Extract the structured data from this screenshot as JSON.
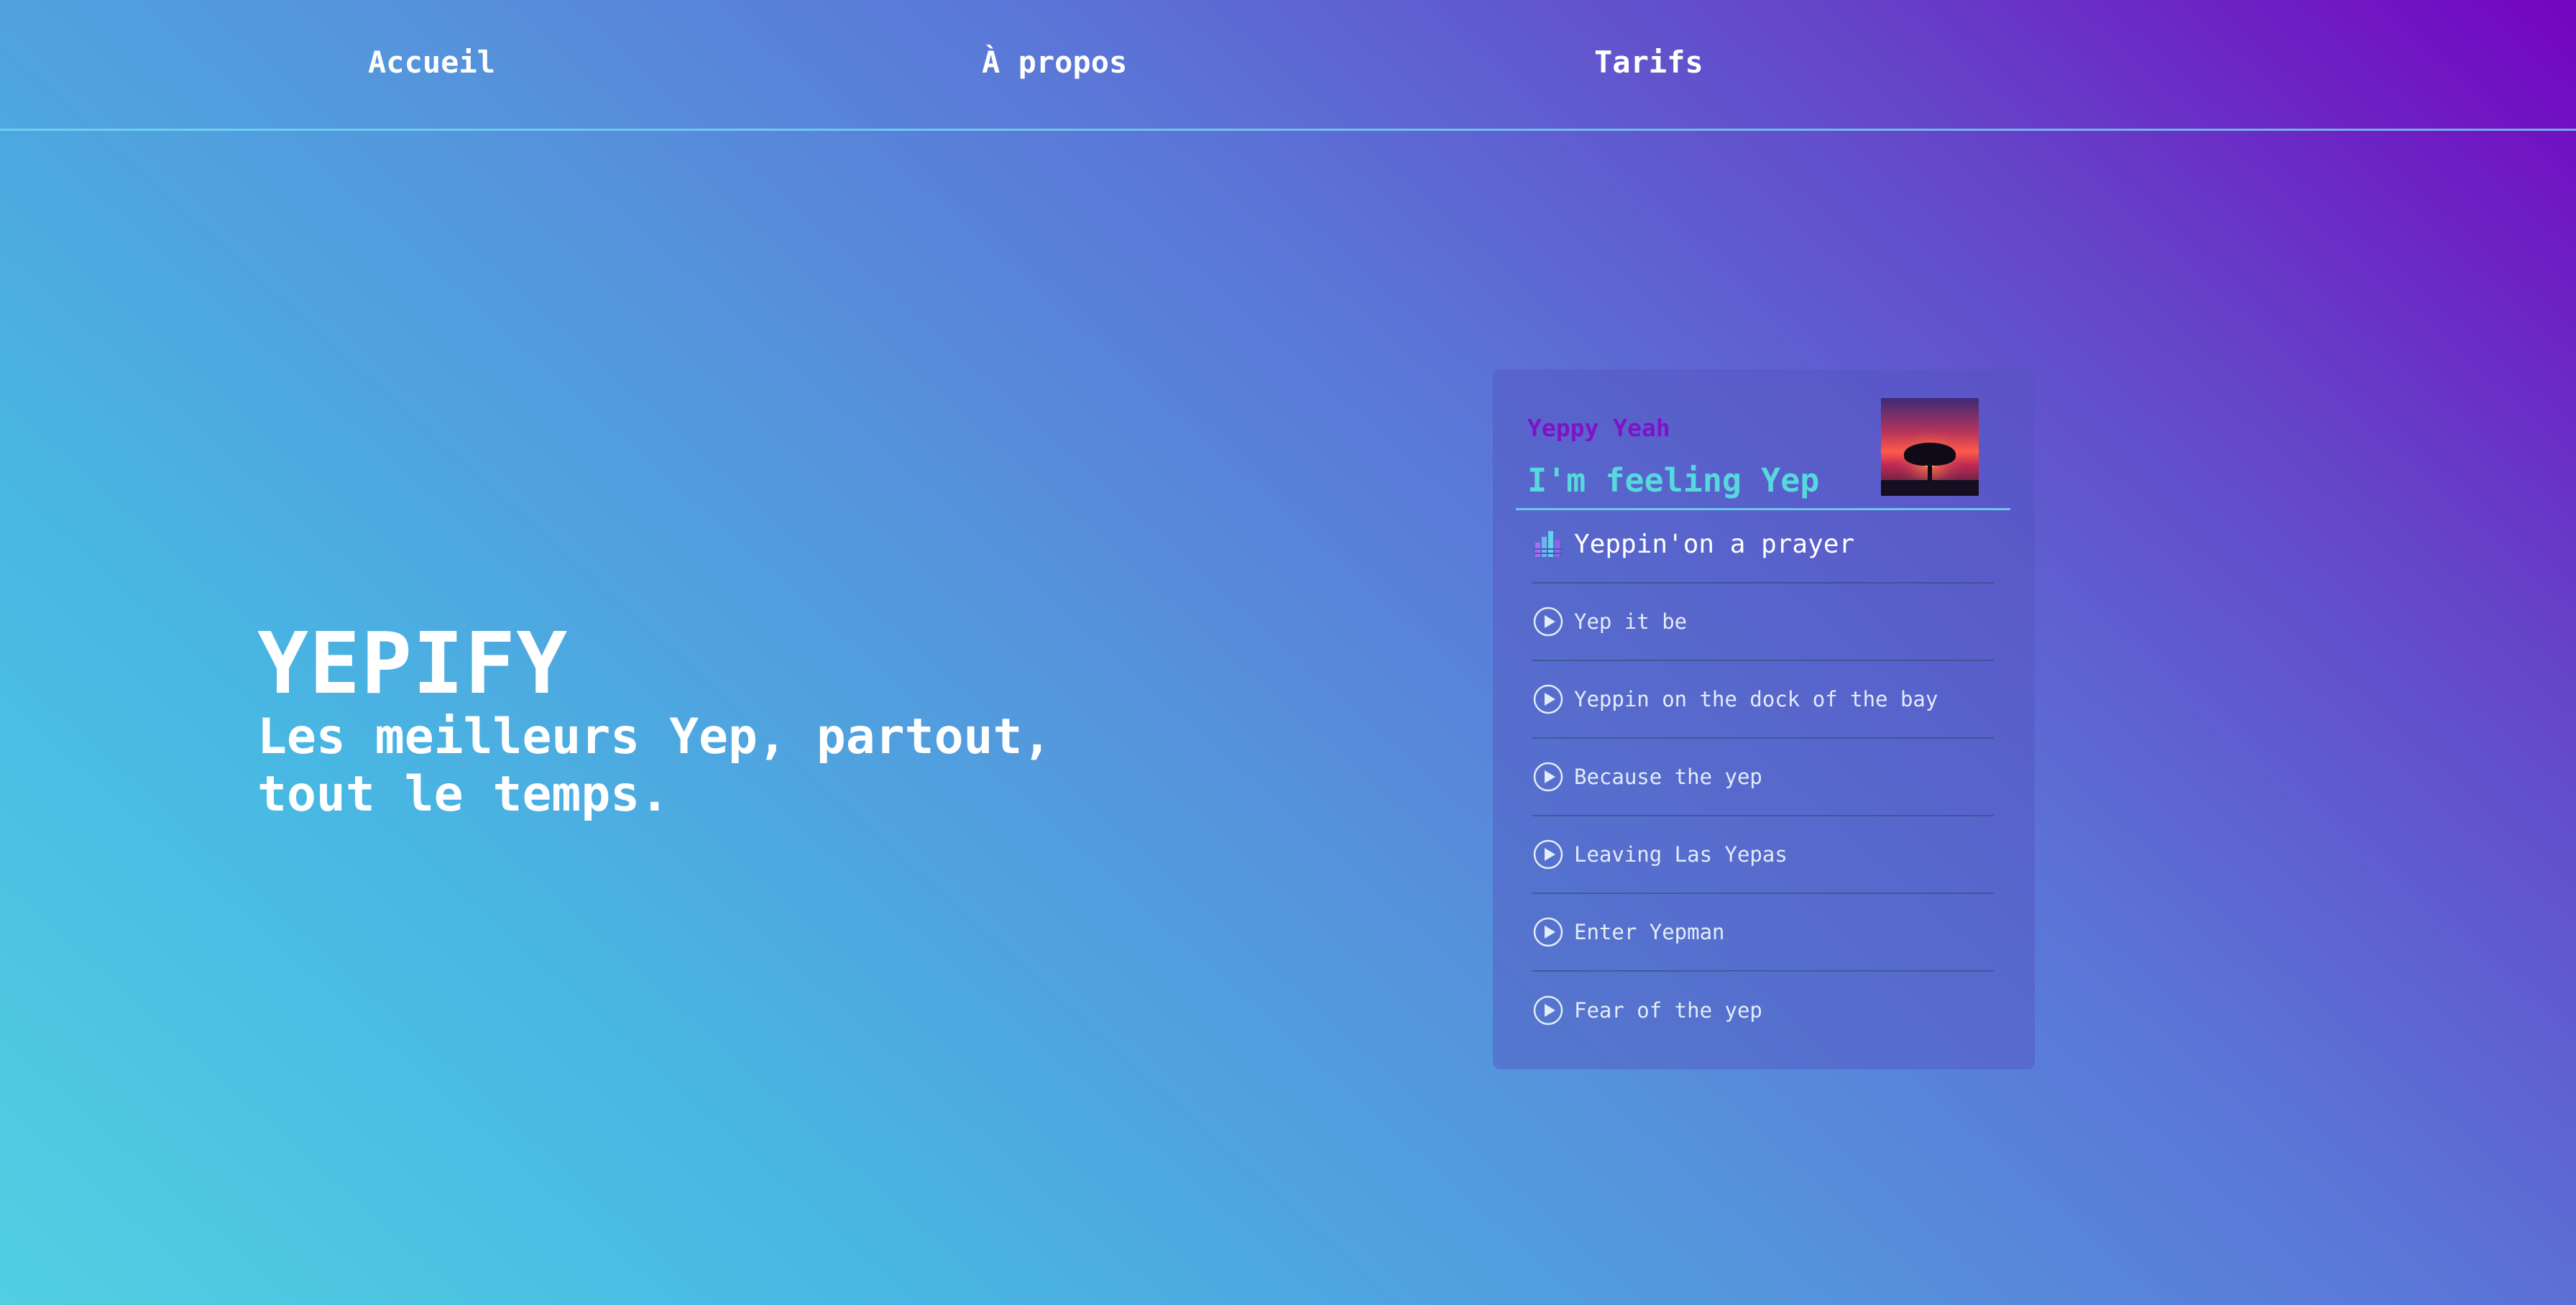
{
  "nav": {
    "home": "Accueil",
    "about": "À propos",
    "pricing": "Tarifs"
  },
  "hero": {
    "title": "YEPIFY",
    "tagline_line1": "Les meilleurs Yep, partout,",
    "tagline_line2": "tout le temps."
  },
  "player": {
    "artist": "Yeppy Yeah",
    "album": "I'm feeling Yep",
    "cover_icon": "album-cover-tree-sunset",
    "tracks": [
      {
        "title": "Yeppin'on a prayer",
        "icon": "equalizer-icon",
        "active": true
      },
      {
        "title": "Yep it be",
        "icon": "play-circle-icon",
        "active": false
      },
      {
        "title": "Yeppin on the dock of the bay",
        "icon": "play-circle-icon",
        "active": false
      },
      {
        "title": "Because the yep",
        "icon": "play-circle-icon",
        "active": false
      },
      {
        "title": "Leaving Las Yepas",
        "icon": "play-circle-icon",
        "active": false
      },
      {
        "title": "Enter Yepman",
        "icon": "play-circle-icon",
        "active": false
      },
      {
        "title": "Fear of the yep",
        "icon": "play-circle-icon",
        "active": false
      }
    ]
  },
  "colors": {
    "artist": "#7f12c6",
    "album": "#56d8dd",
    "gradient_start": "#52cfe2",
    "gradient_end": "#7404c0"
  }
}
